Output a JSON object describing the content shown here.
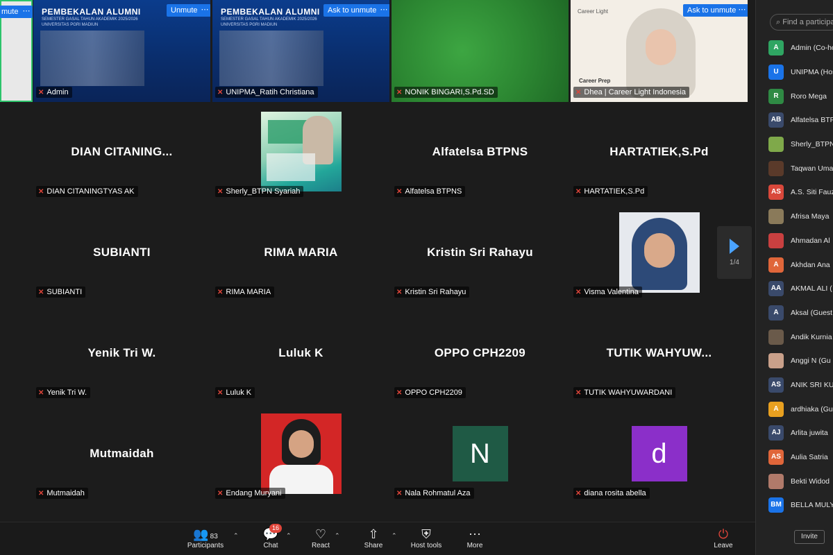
{
  "top_row": {
    "edge": {
      "button": "mute"
    },
    "admin": {
      "name": "Admin",
      "slide_title": "PEMBEKALAN ALUMNI",
      "slide_sub": "SEMESTER GASAL TAHUN AKADEMIK 2025/2026 UNIVERSITAS PGRI MADIUN",
      "button": "Unmute"
    },
    "ratih": {
      "name": "UNIPMA_Ratih Christiana",
      "slide_title": "PEMBEKALAN ALUMNI",
      "slide_sub": "SEMESTER GASAL TAHUN AKADEMIK 2025/2026 UNIVERSITAS PGRI MADIUN",
      "button": "Ask to unmute"
    },
    "nonik": {
      "name": "NONIK BINGARI,S.Pd.SD"
    },
    "dhea": {
      "name": "Dhea | Career Light Indonesia",
      "logo": "Career Light",
      "slide_text": "Career Prep",
      "button": "Ask to unmute"
    }
  },
  "tiles": [
    {
      "display": "DIAN  CITANING...",
      "name": "DIAN CITANINGTYAS AK"
    },
    {
      "display": "",
      "name": "Sherly_BTPN Syariah"
    },
    {
      "display": "Alfatelsa BTPNS",
      "name": "Alfatelsa BTPNS"
    },
    {
      "display": "HARTATIEK,S.Pd",
      "name": "HARTATIEK,S.Pd"
    },
    {
      "display": "SUBIANTI",
      "name": "SUBIANTI"
    },
    {
      "display": "RIMA MARIA",
      "name": "RIMA MARIA"
    },
    {
      "display": "Kristin Sri Rahayu",
      "name": "Kristin Sri Rahayu"
    },
    {
      "display": "",
      "name": "Visma Valentina"
    },
    {
      "display": "Yenik Tri W.",
      "name": "Yenik Tri W."
    },
    {
      "display": "Luluk K",
      "name": "Luluk K"
    },
    {
      "display": "OPPO CPH2209",
      "name": "OPPO CPH2209"
    },
    {
      "display": "TUTIK  WAHYUW...",
      "name": "TUTIK WAHYUWARDANI"
    },
    {
      "display": "Mutmaidah",
      "name": "Mutmaidah"
    },
    {
      "display": "",
      "name": "Endang Muryani"
    },
    {
      "display": "N",
      "name": "Nala Rohmatul Aza"
    },
    {
      "display": "d",
      "name": "diana rosita abella"
    }
  ],
  "pager": {
    "count": "1/4"
  },
  "toolbar": {
    "participants_label": "Participants",
    "participants_count": "83",
    "chat_label": "Chat",
    "chat_badge": "16",
    "react_label": "React",
    "share_label": "Share",
    "host_tools_label": "Host tools",
    "more_label": "More",
    "leave_label": "Leave"
  },
  "sidebar": {
    "search_placeholder": "Find a participant",
    "invite_label": "Invite",
    "participants": [
      {
        "initials": "A",
        "name": "Admin (Co-host)",
        "color": "#2fa562"
      },
      {
        "initials": "U",
        "name": "UNIPMA (Host)",
        "color": "#1a73e8"
      },
      {
        "initials": "R",
        "name": "Roro Mega",
        "color": "#2f8a44"
      },
      {
        "initials": "AB",
        "name": "Alfatelsa BTPNS",
        "color": "#3a4a6b"
      },
      {
        "initials": "",
        "name": "Sherly_BTPN",
        "color": "#7fa94a"
      },
      {
        "initials": "",
        "name": "Taqwan Uma",
        "color": "#5a3a2a"
      },
      {
        "initials": "AS",
        "name": "A.S. Siti Fauz",
        "color": "#d9483b"
      },
      {
        "initials": "",
        "name": "Afrisa Maya",
        "color": "#8a7a5a"
      },
      {
        "initials": "",
        "name": "Ahmadan Al",
        "color": "#c94040"
      },
      {
        "initials": "A",
        "name": "Akhdan Ana",
        "color": "#e0663a"
      },
      {
        "initials": "AA",
        "name": "AKMAL ALI (",
        "color": "#3a4a6b"
      },
      {
        "initials": "A",
        "name": "Aksal (Guest",
        "color": "#3a4a6b"
      },
      {
        "initials": "",
        "name": "Andik Kurnia",
        "color": "#6a5a4a"
      },
      {
        "initials": "",
        "name": "Anggi N (Gu",
        "color": "#c9a08a"
      },
      {
        "initials": "AS",
        "name": "ANIK SRI KU",
        "color": "#3a4a6b"
      },
      {
        "initials": "A",
        "name": "ardhiaka (Gu",
        "color": "#e8a020"
      },
      {
        "initials": "AJ",
        "name": "Arlita juwita",
        "color": "#3a4a6b"
      },
      {
        "initials": "AS",
        "name": "Aulia Satria",
        "color": "#e0663a"
      },
      {
        "initials": "",
        "name": "Bekti Widod",
        "color": "#b07a6a"
      },
      {
        "initials": "BM",
        "name": "BELLA MULY",
        "color": "#1a73e8"
      }
    ]
  }
}
